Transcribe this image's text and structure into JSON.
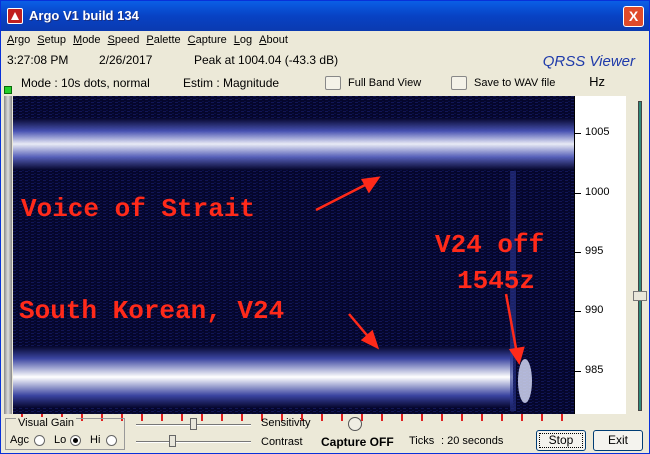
{
  "window": {
    "title": "Argo V1 build 134",
    "close_glyph": "X"
  },
  "menu": [
    "Argo",
    "Setup",
    "Mode",
    "Speed",
    "Palette",
    "Capture",
    "Log",
    "About"
  ],
  "status": {
    "time": "3:27:08 PM",
    "date": "2/26/2017",
    "peak": "Peak at 1004.04 (-43.3 dB)",
    "brand": "QRSS Viewer"
  },
  "mode_row": {
    "mode": "Mode : 10s dots, normal",
    "estim": "Estim : Magnitude",
    "full_band": "Full Band View",
    "save_wav": "Save to WAV file",
    "hz": "Hz"
  },
  "axis": {
    "unit": "Hz",
    "labels": [
      "1005",
      "1000",
      "995",
      "990",
      "985"
    ]
  },
  "annotations": {
    "voice": "Voice of Strait",
    "v24_off_1": "V24 off",
    "v24_off_2": "1545z",
    "south_korean": "South Korean, V24"
  },
  "bottom": {
    "visual_gain": "Visual Gain",
    "agc": "Agc",
    "lo": "Lo",
    "hi": "Hi",
    "selected_gain": "Lo",
    "sensitivity": "Sensitivity",
    "contrast": "Contrast",
    "capture": "Capture OFF",
    "ticks": "Ticks",
    "ticks_value": ": 20 seconds",
    "stop": "Stop",
    "exit": "Exit"
  },
  "colors": {
    "annotation": "#FF2A1A",
    "spectro_bg": "#05062C",
    "signal": "#FFFFFF"
  }
}
